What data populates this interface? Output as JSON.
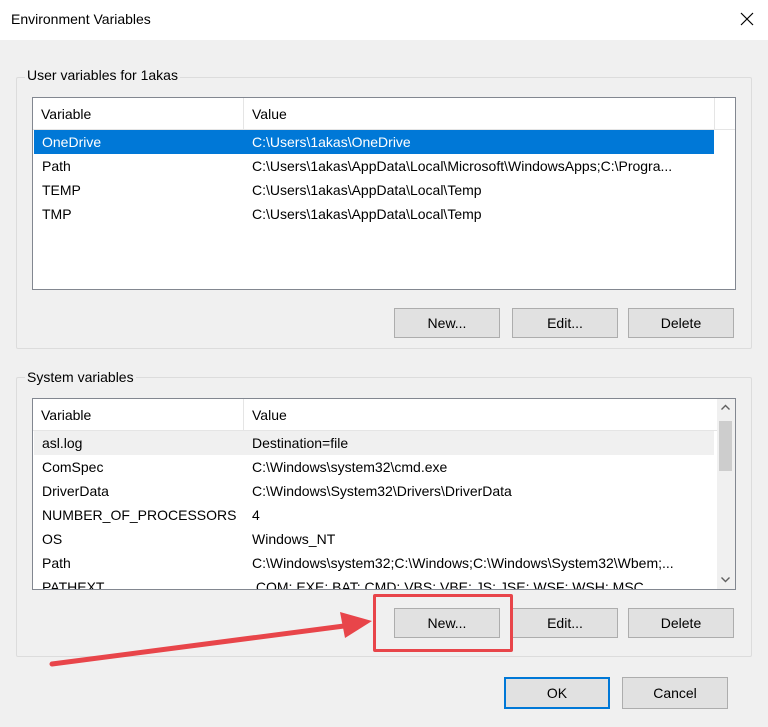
{
  "window": {
    "title": "Environment Variables"
  },
  "user_section": {
    "label": "User variables for 1akas",
    "columns": [
      "Variable",
      "Value"
    ],
    "rows": [
      {
        "variable": "OneDrive",
        "value": "C:\\Users\\1akas\\OneDrive"
      },
      {
        "variable": "Path",
        "value": "C:\\Users\\1akas\\AppData\\Local\\Microsoft\\WindowsApps;C:\\Progra..."
      },
      {
        "variable": "TEMP",
        "value": "C:\\Users\\1akas\\AppData\\Local\\Temp"
      },
      {
        "variable": "TMP",
        "value": "C:\\Users\\1akas\\AppData\\Local\\Temp"
      }
    ],
    "selected_index": 0,
    "buttons": {
      "new": "New...",
      "edit": "Edit...",
      "delete": "Delete"
    }
  },
  "system_section": {
    "label": "System variables",
    "columns": [
      "Variable",
      "Value"
    ],
    "rows": [
      {
        "variable": "asl.log",
        "value": "Destination=file"
      },
      {
        "variable": "ComSpec",
        "value": "C:\\Windows\\system32\\cmd.exe"
      },
      {
        "variable": "DriverData",
        "value": "C:\\Windows\\System32\\Drivers\\DriverData"
      },
      {
        "variable": "NUMBER_OF_PROCESSORS",
        "value": "4"
      },
      {
        "variable": "OS",
        "value": "Windows_NT"
      },
      {
        "variable": "Path",
        "value": "C:\\Windows\\system32;C:\\Windows;C:\\Windows\\System32\\Wbem;..."
      },
      {
        "variable": "PATHEXT",
        "value": ".COM;.EXE;.BAT;.CMD;.VBS;.VBE;.JS;.JSE;.WSF;.WSH;.MSC"
      }
    ],
    "focused_index": 0,
    "buttons": {
      "new": "New...",
      "edit": "Edit...",
      "delete": "Delete"
    }
  },
  "footer": {
    "ok": "OK",
    "cancel": "Cancel"
  },
  "colors": {
    "selection": "#0078d7",
    "annotation": "#e8454a"
  },
  "icons": {
    "close": "close-icon",
    "scroll_up": "chevron-up-icon",
    "scroll_down": "chevron-down-icon"
  }
}
